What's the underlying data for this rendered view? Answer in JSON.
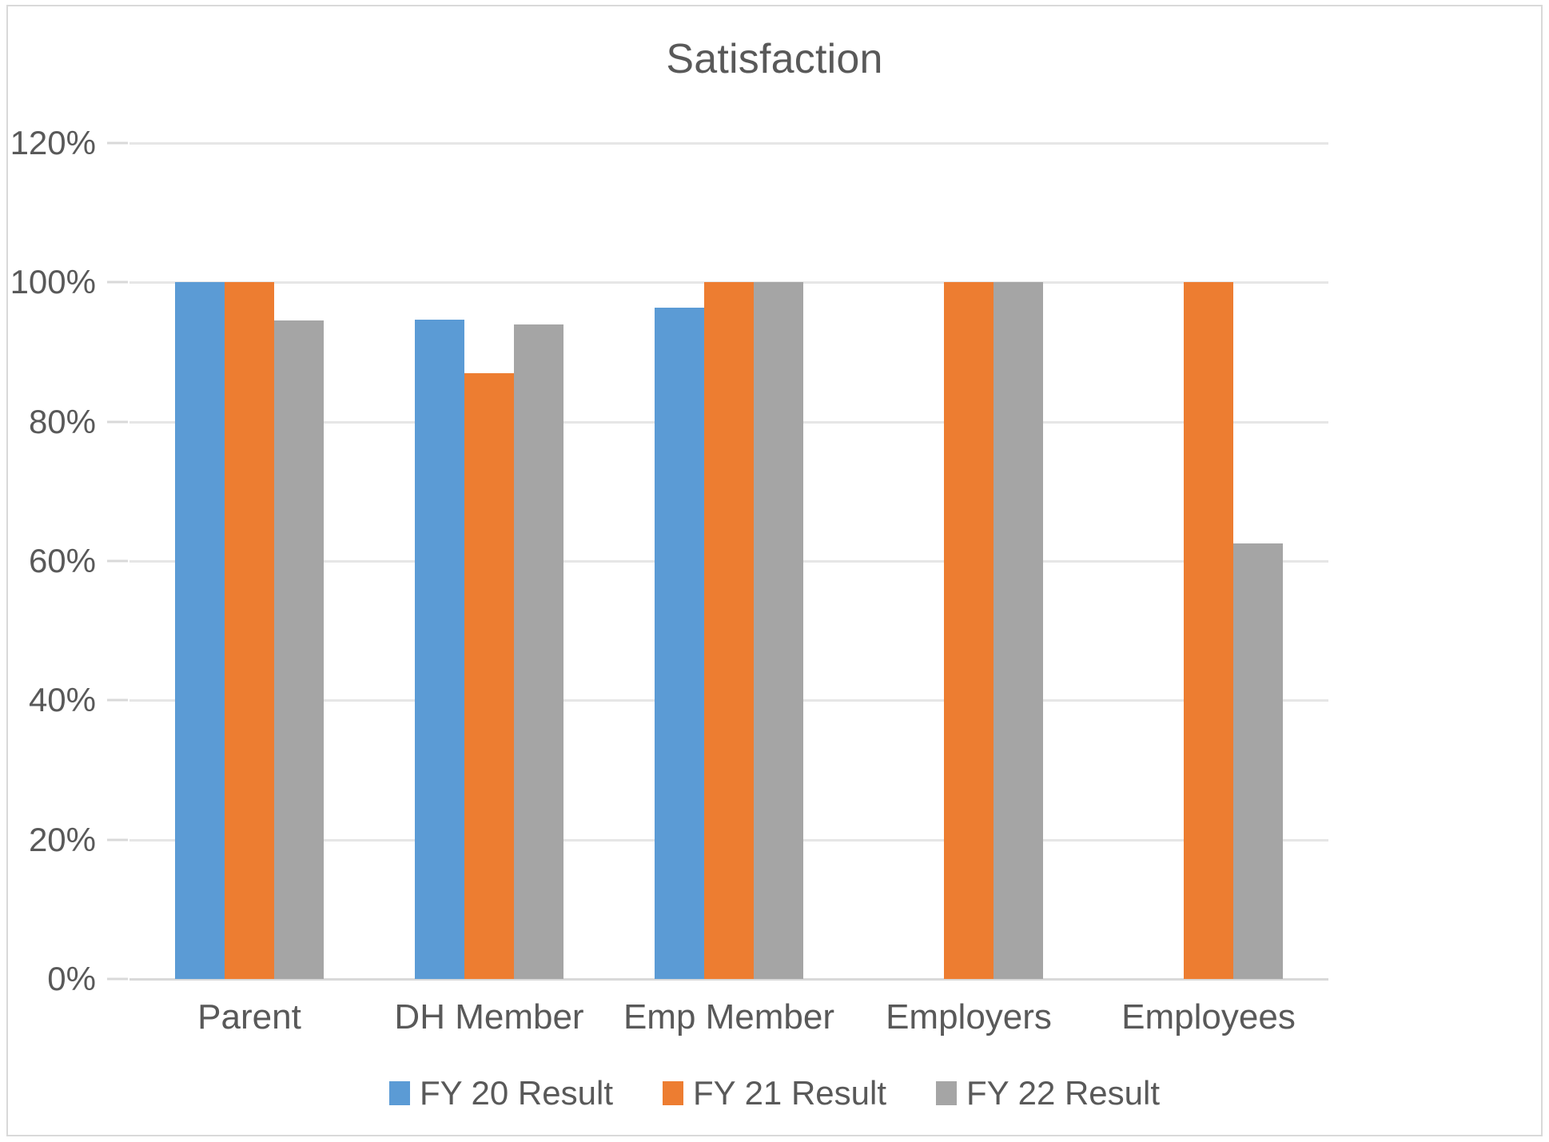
{
  "chart_data": {
    "type": "bar",
    "title": "Satisfaction",
    "xlabel": "",
    "ylabel": "",
    "ylim": [
      0,
      120
    ],
    "y_unit": "%",
    "grid": true,
    "legend_position": "bottom",
    "categories": [
      "Parent",
      "DH Member",
      "Emp Member",
      "Employers",
      "Employees"
    ],
    "yticks": [
      {
        "value": 120,
        "label": "120%"
      },
      {
        "value": 100,
        "label": "100%"
      },
      {
        "value": 80,
        "label": "80%"
      },
      {
        "value": 60,
        "label": "60%"
      },
      {
        "value": 40,
        "label": "40%"
      },
      {
        "value": 20,
        "label": "20%"
      },
      {
        "value": 0,
        "label": "0%"
      }
    ],
    "series": [
      {
        "name": "FY 20 Result",
        "color": "#5b9bd5",
        "values": [
          100,
          94.7,
          96.4,
          null,
          null
        ]
      },
      {
        "name": "FY 21 Result",
        "color": "#ed7d31",
        "values": [
          100,
          87,
          100,
          100,
          100
        ]
      },
      {
        "name": "FY 22 Result",
        "color": "#a5a5a5",
        "values": [
          94.5,
          94,
          100,
          100,
          62.5
        ]
      }
    ]
  },
  "colors": {
    "title": "#595959",
    "axis_text": "#595959",
    "gridline": "#e6e6e6",
    "frame_border": "#d9d9d9",
    "background": "#ffffff",
    "series_1": "#5b9bd5",
    "series_2": "#ed7d31",
    "series_3": "#a5a5a5"
  }
}
